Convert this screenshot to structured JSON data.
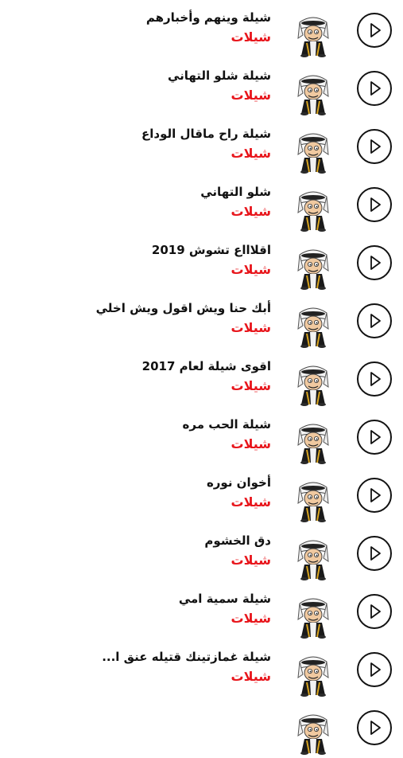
{
  "items": [
    {
      "title": "شيلة  وينهم وأخبارهم",
      "category": "شيلات"
    },
    {
      "title": "شيلة شلو التهاني",
      "category": "شيلات"
    },
    {
      "title": "شيلة راح ماقال الوداع",
      "category": "شيلات"
    },
    {
      "title": "شلو التهاني",
      "category": "شيلات"
    },
    {
      "title": "اقلاااع تشوش 2019",
      "category": "شيلات"
    },
    {
      "title": "أبك حنا ويش اقول ويش اخلي",
      "category": "شيلات"
    },
    {
      "title": "اقوى شيلة لعام 2017",
      "category": "شيلات"
    },
    {
      "title": "شيلة الحب مره",
      "category": "شيلات"
    },
    {
      "title": "أخوان نوره",
      "category": "شيلات"
    },
    {
      "title": "دق الخشوم",
      "category": "شيلات"
    },
    {
      "title": "شيلة سمية امي",
      "category": "شيلات"
    },
    {
      "title": "شيلة غمازتينك قتيله  عنق ا...",
      "category": "شيلات"
    },
    {
      "title": "",
      "category": ""
    }
  ],
  "icons": {
    "play": "play-circle-icon",
    "avatar": "cartoon-avatar-icon"
  },
  "colors": {
    "category": "#e8151b",
    "title": "#111111",
    "background": "#ffffff"
  }
}
